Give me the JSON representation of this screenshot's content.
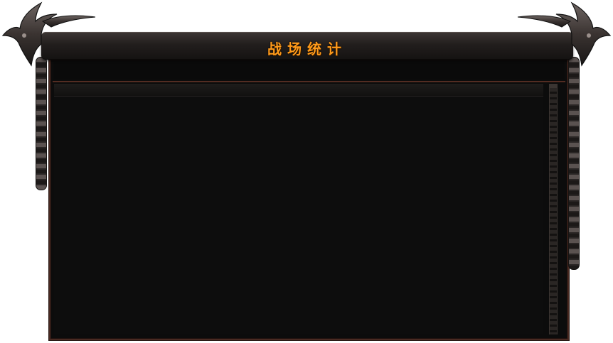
{
  "window": {
    "title": "战场统计"
  },
  "colors": {
    "title_text": "#ff9a1a",
    "panel_bg": "#0c0c0c",
    "panel_border": "#4a2a22",
    "frame_metal": "#3b3533"
  },
  "icons": {
    "left_ornament": "blade-ornament-icon",
    "right_ornament": "blade-ornament-icon",
    "chain": "chain-icon"
  }
}
